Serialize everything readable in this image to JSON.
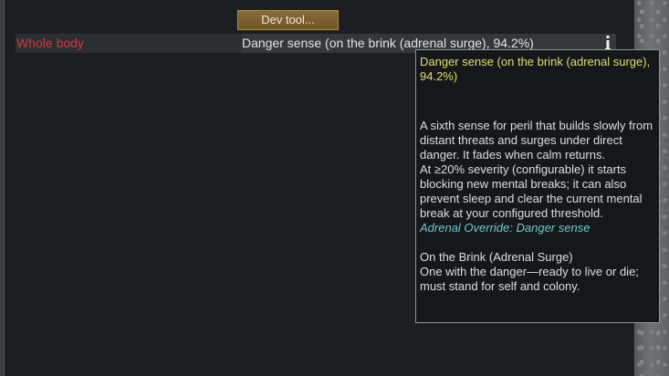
{
  "dev_button": {
    "label": "Dev tool..."
  },
  "health_row": {
    "part": "Whole body",
    "hediff": "Danger sense (on the brink (adrenal surge), 94.2%)",
    "info_icon": "info-icon"
  },
  "tooltip": {
    "title": "Danger sense (on the brink (adrenal surge), 94.2%)",
    "description_1": "A sixth sense for peril that builds slowly from distant threats and surges under direct danger. It fades when calm returns.",
    "description_2": "At ≥20% severity (configurable) it starts blocking new mental breaks; it can also prevent sleep and clear the current mental break at your configured threshold.",
    "override": "Adrenal Override: Danger sense",
    "stage_name": "On the Brink (Adrenal Surge)",
    "stage_desc": "One with the danger—ready to live or die; must stand for self and colony."
  },
  "colors": {
    "part_label": "#d7393a",
    "title": "#e5de6e",
    "override": "#6fc8cf",
    "button": "#7a5e32"
  }
}
